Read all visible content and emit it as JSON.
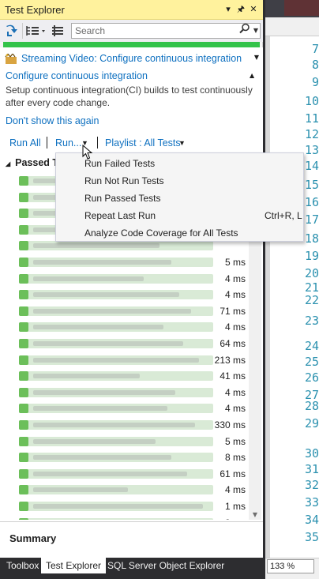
{
  "window": {
    "title": "Test Explorer"
  },
  "title_buttons": {
    "pin": "▾",
    "autohide": "🖈",
    "close": "✕"
  },
  "search": {
    "placeholder": "Search"
  },
  "progress": {
    "fraction": 1.0,
    "color": "#33c34a"
  },
  "banner": {
    "video_label": "Streaming Video: Configure continuous integration",
    "heading": "Configure continuous integration",
    "description": "Setup continuous integration(CI) builds to test continuously after every code change.",
    "dismiss": "Don't show this again"
  },
  "runbar": {
    "run_all": "Run All",
    "run": "Run...",
    "playlist": "Playlist : All Tests"
  },
  "tests": {
    "group_label": "Passed T",
    "times": [
      "",
      "",
      "",
      "",
      "",
      "5 ms",
      "4 ms",
      "4 ms",
      "71 ms",
      "4 ms",
      "64 ms",
      "213 ms",
      "41 ms",
      "4 ms",
      "4 ms",
      "330 ms",
      "5 ms",
      "8 ms",
      "61 ms",
      "4 ms",
      "1 ms",
      "3 ms"
    ]
  },
  "summary": {
    "title": "Summary"
  },
  "bottom_tabs": [
    {
      "label": "Toolbox",
      "active": false
    },
    {
      "label": "Test Explorer",
      "active": true
    },
    {
      "label": "SQL Server Object Explorer",
      "active": false
    }
  ],
  "editor": {
    "line_numbers": [
      "7",
      "8",
      "9",
      "10",
      "11",
      "12",
      "13",
      "14",
      "15",
      "16",
      "17",
      "18",
      "19",
      "20",
      "21",
      "22",
      "23",
      "24",
      "25",
      "26",
      "27",
      "28",
      "29",
      "30",
      "31",
      "32",
      "33",
      "34",
      "35"
    ],
    "zoom": "133 %"
  },
  "menu": {
    "items": [
      {
        "label": "Run Failed Tests",
        "shortcut": ""
      },
      {
        "label": "Run Not Run Tests",
        "shortcut": ""
      },
      {
        "label": "Run Passed Tests",
        "shortcut": ""
      },
      {
        "label": "Repeat Last Run",
        "shortcut": "Ctrl+R, L"
      },
      {
        "label": "Analyze Code Coverage for All Tests",
        "shortcut": ""
      }
    ]
  }
}
